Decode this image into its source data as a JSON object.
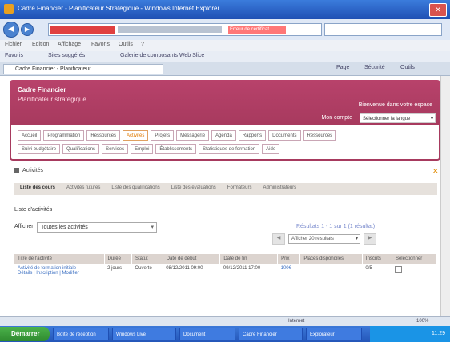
{
  "window": {
    "title": "Cadre Financier - Planificateur Stratégique - Windows Internet Explorer",
    "close": "✕"
  },
  "browser": {
    "back": "◀",
    "forward": "▶",
    "url_tag": "Erreur de certificat",
    "menu": [
      "Fichier",
      "Edition",
      "Affichage",
      "Favoris",
      "Outils",
      "?"
    ],
    "favorites": [
      "Favoris",
      "Sites suggérés",
      "Galerie de composants Web Slice"
    ],
    "tab_title": "Cadre Financier - Planificateur",
    "tools": [
      "Page",
      "Sécurité",
      "Outils"
    ]
  },
  "header": {
    "brand": "Cadre Financier",
    "brand2": "Planificateur stratégique",
    "welcome": "Bienvenue dans votre espace",
    "user_link": "Mon compte",
    "language": "Sélectionner la langue",
    "language_arrow": "▾"
  },
  "nav": {
    "row1": [
      {
        "label": "Accueil",
        "active": false
      },
      {
        "label": "Programmation",
        "active": false
      },
      {
        "label": "Ressources",
        "active": false
      },
      {
        "label": "Activités",
        "active": true
      },
      {
        "label": "Projets",
        "active": false
      },
      {
        "label": "Messagerie",
        "active": false
      },
      {
        "label": "Agenda",
        "active": false
      },
      {
        "label": "Rapports",
        "active": false
      },
      {
        "label": "Documents",
        "active": false
      },
      {
        "label": "Ressources",
        "active": false
      }
    ],
    "row2": [
      {
        "label": "Suivi budgétaire"
      },
      {
        "label": "Qualifications"
      },
      {
        "label": "Services"
      },
      {
        "label": "Emploi"
      },
      {
        "label": "Établissements"
      },
      {
        "label": "Statistiques de formation"
      },
      {
        "label": "Aide"
      }
    ]
  },
  "section": {
    "title": "Activités",
    "close": "✕",
    "subtabs": [
      {
        "label": "Liste des cours",
        "active": true
      },
      {
        "label": "Activités futures",
        "active": false
      },
      {
        "label": "Liste des qualifications",
        "active": false
      },
      {
        "label": "Liste des évaluations",
        "active": false
      },
      {
        "label": "Formateurs",
        "active": false
      },
      {
        "label": "Administrateurs",
        "active": false
      }
    ]
  },
  "list": {
    "label": "Liste d'activités",
    "show_label": "Afficher",
    "show_value": "Toutes les activités",
    "summary": "Résultats 1 - 1 sur 1 (1 résultat)",
    "page_size": "Afficher 20 résultats",
    "prev": "◀",
    "next": "▶",
    "columns": [
      "Titre de l'activité",
      "Durée",
      "Statut",
      "Date de début",
      "Date de fin",
      "Prix",
      "Places disponibles",
      "Inscrits",
      "Sélectionner"
    ],
    "rows": [
      {
        "title": "Activité de formation initiale",
        "sublinks": "Détails | Inscription | Modifier",
        "duration": "2 jours",
        "status": "Ouverte",
        "start": "08/12/2011 09:00",
        "end": "09/12/2011 17:00",
        "price": "100€",
        "seats": "",
        "enrolled": "0/5"
      }
    ]
  },
  "statusbar": {
    "zone": "Internet",
    "zoom": "100%"
  },
  "taskbar": {
    "start": "Démarrer",
    "tasks": [
      "Boîte de réception",
      "Windows Live",
      "Document",
      "Cadre Financier",
      "Explorateur"
    ],
    "clock": "11:29"
  }
}
